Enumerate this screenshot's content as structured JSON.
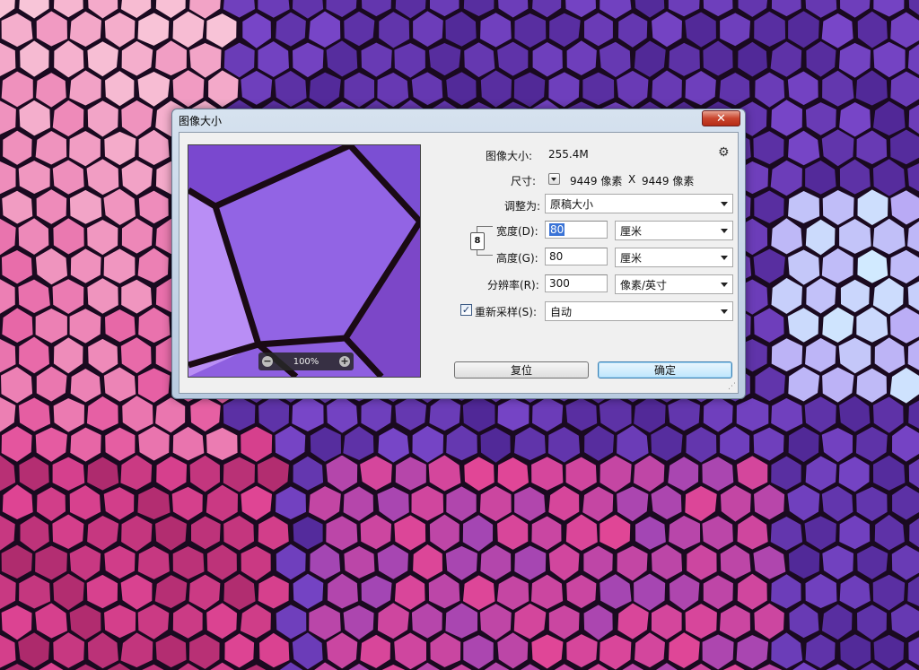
{
  "dialog": {
    "title": "图像大小",
    "close_glyph": "✕",
    "image_size_label": "图像大小:",
    "image_size_value": "255.4M",
    "dimensions_label": "尺寸:",
    "dimensions_width": "9449 像素",
    "dimensions_x": "X",
    "dimensions_height": "9449 像素",
    "fit_label": "调整为:",
    "fit_value": "原稿大小",
    "width_label": "宽度(D):",
    "width_value": "80",
    "width_unit": "厘米",
    "height_label": "高度(G):",
    "height_value": "80",
    "height_unit": "厘米",
    "resolution_label": "分辨率(R):",
    "resolution_value": "300",
    "resolution_unit": "像素/英寸",
    "resample_label": "重新采样(S):",
    "resample_checked": true,
    "resample_value": "自动",
    "reset_button": "复位",
    "ok_button": "确定",
    "preview_zoom": "100%",
    "zoom_out_glyph": "−",
    "zoom_in_glyph": "+",
    "gear_glyph": "⚙",
    "check_glyph": "✓",
    "link_glyph": "8"
  },
  "colors": {
    "accent_selection": "#3a73d6",
    "close_button": "#c9442d",
    "background_purple": "#5b2fa0",
    "background_pink": "#e04c9a"
  }
}
